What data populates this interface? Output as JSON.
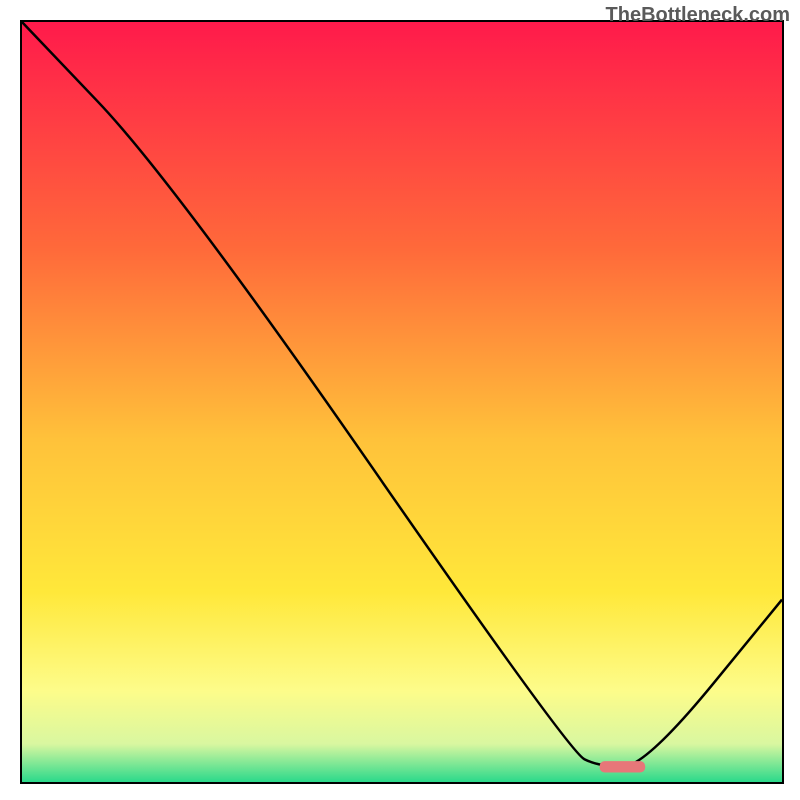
{
  "watermark": "TheBottleneck.com",
  "chart_data": {
    "type": "line",
    "title": "",
    "xlabel": "",
    "ylabel": "",
    "xlim": [
      0,
      100
    ],
    "ylim": [
      0,
      100
    ],
    "series": [
      {
        "name": "curve",
        "x": [
          0,
          20,
          72,
          76,
          82,
          100
        ],
        "y": [
          100,
          79,
          4,
          2,
          2,
          24
        ]
      }
    ],
    "marker": {
      "x": 79,
      "y": 2,
      "width": 6,
      "height": 1.5,
      "color": "#e77779"
    },
    "gradient_stops": [
      {
        "offset": 0.0,
        "color": "#ff1a4b"
      },
      {
        "offset": 0.3,
        "color": "#ff6a3a"
      },
      {
        "offset": 0.55,
        "color": "#ffc23a"
      },
      {
        "offset": 0.75,
        "color": "#ffe83a"
      },
      {
        "offset": 0.88,
        "color": "#fdfc8a"
      },
      {
        "offset": 0.95,
        "color": "#d9f7a0"
      },
      {
        "offset": 1.0,
        "color": "#2bd98b"
      }
    ]
  }
}
